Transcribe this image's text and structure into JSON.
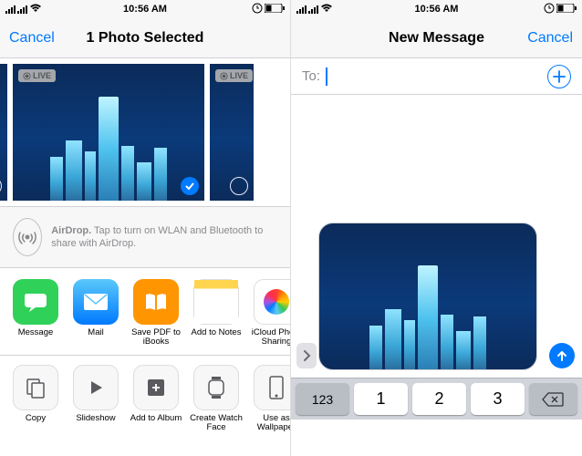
{
  "status": {
    "time": "10:56 AM"
  },
  "left": {
    "nav": {
      "cancel": "Cancel",
      "title": "1 Photo Selected"
    },
    "live_badge": "LIVE",
    "airdrop": {
      "bold": "AirDrop.",
      "text": " Tap to turn on WLAN and Bluetooth to share with AirDrop."
    },
    "apps": {
      "message": "Message",
      "mail": "Mail",
      "ibooks": "Save PDF to iBooks",
      "notes": "Add to Notes",
      "icloud": "iCloud Photo Sharing"
    },
    "actions": {
      "copy": "Copy",
      "slideshow": "Slideshow",
      "album": "Add to Album",
      "watchface": "Create Watch Face",
      "wallpaper": "Use as Wallpaper"
    }
  },
  "right": {
    "nav": {
      "title": "New Message",
      "cancel": "Cancel"
    },
    "to_label": "To:",
    "keys": {
      "mode": "123",
      "k1": "1",
      "k2": "2",
      "k3": "3"
    }
  }
}
